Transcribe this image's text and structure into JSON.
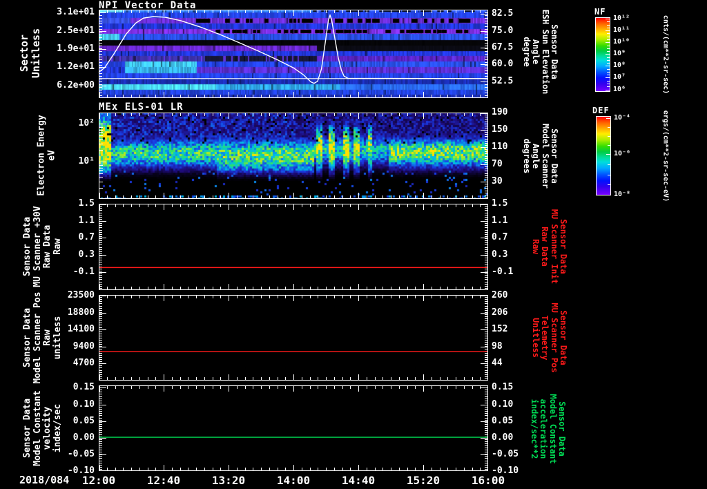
{
  "figure": {
    "background": "#000000",
    "date_label": "2018/084",
    "x_tick_labels": [
      "12:00",
      "12:40",
      "13:20",
      "14:00",
      "14:40",
      "15:20",
      "16:00"
    ]
  },
  "panels": [
    {
      "title": "NPI Vector Data",
      "left_label_lines": [
        "Sector",
        "Unitless"
      ],
      "left_ticks": [
        "3.1e+01",
        "2.5e+01",
        "1.9e+01",
        "1.2e+01",
        "6.2e+00"
      ],
      "right_ticks": [
        "82.5",
        "75.0",
        "67.5",
        "60.0",
        "52.5"
      ],
      "right_label_lines": [
        "Sensor Data",
        "ESH Sun Elevation",
        "Angle",
        "degree"
      ],
      "right_label_color": "#ffffff"
    },
    {
      "title": "MEx ELS-01 LR",
      "left_label_lines": [
        "Electron Energy",
        "eV"
      ],
      "left_ticks": [
        "10²",
        "10¹"
      ],
      "right_ticks": [
        "190",
        "150",
        "110",
        "70",
        "30"
      ],
      "right_label_lines": [
        "Sensor Data",
        "Model Scanner",
        "Angle",
        "degrees"
      ],
      "right_label_color": "#ffffff"
    },
    {
      "title": "",
      "left_label_lines": [
        "Sensor Data",
        "MU Scanner +30V",
        "Raw Data",
        "Raw"
      ],
      "left_ticks": [
        "1.5",
        "1.1",
        "0.7",
        "0.3",
        "-0.1"
      ],
      "right_ticks": [
        "1.5",
        "1.1",
        "0.7",
        "0.3",
        "-0.1"
      ],
      "right_label_lines": [
        "Sensor Data",
        "MU Scanner Init",
        "Raw Data",
        "Raw"
      ],
      "right_label_color": "#ff1a1a"
    },
    {
      "title": "",
      "left_label_lines": [
        "Sensor Data",
        "Model Scanner Pos",
        "Raw",
        "unitless"
      ],
      "left_ticks": [
        "23500",
        "18800",
        "14100",
        "9400",
        "4700"
      ],
      "right_ticks": [
        "260",
        "206",
        "152",
        "98",
        "44"
      ],
      "right_label_lines": [
        "Sensor Data",
        "MU Scanner Pos",
        "Telemetry",
        "Unitless"
      ],
      "right_label_color": "#ff1a1a"
    },
    {
      "title": "",
      "left_label_lines": [
        "Sensor Data",
        "Model Constant",
        "velocity",
        "index/sec"
      ],
      "left_ticks": [
        "0.15",
        "0.10",
        "0.05",
        "0.00",
        "-0.05",
        "-0.10"
      ],
      "right_ticks": [
        "0.15",
        "0.10",
        "0.05",
        "0.00",
        "-0.05",
        "-0.10"
      ],
      "right_label_lines": [
        "Sensor Data",
        "Model Constant",
        "acceleration",
        "index/sec**2"
      ],
      "right_label_color": "#00dd55"
    }
  ],
  "colorbars": [
    {
      "title": "NF",
      "tick_labels": [
        "10¹²",
        "10¹¹",
        "10¹⁰",
        "10⁹",
        "10⁸",
        "10⁷",
        "10⁶"
      ],
      "unit": "cnts/(cm**2-sr-sec)"
    },
    {
      "title": "DEF",
      "tick_labels": [
        "10⁻⁴",
        "10⁻⁶",
        "10⁻⁸"
      ],
      "unit": "ergs/(cm**2-sr-sec-eV)"
    }
  ],
  "chart_data": [
    {
      "type": "heatmap",
      "title": "NPI Vector Data",
      "ylabel": "Sector (Unitless)",
      "yticks": [
        "3.1e+01",
        "2.5e+01",
        "1.9e+01",
        "1.2e+01",
        "6.2e+00"
      ],
      "x_range": [
        "2018/084 12:00",
        "2018/084 16:00"
      ],
      "colorbar": {
        "name": "NF",
        "unit": "cnts/(cm**2-sr-sec)",
        "log_range": [
          1000000,
          1000000000000
        ]
      },
      "right_axis": {
        "label": "Sensor Data ESH Sun Elevation Angle (degree)",
        "ticks": [
          82.5,
          75.0,
          67.5,
          60.0,
          52.5
        ]
      },
      "sun_elevation_line": {
        "color": "#ffffff",
        "points": [
          [
            0,
            56.5
          ],
          [
            0.015,
            58.5
          ],
          [
            0.04,
            65
          ],
          [
            0.07,
            73.5
          ],
          [
            0.095,
            78.5
          ],
          [
            0.115,
            80.7
          ],
          [
            0.14,
            81.4
          ],
          [
            0.17,
            81.1
          ],
          [
            0.21,
            79.6
          ],
          [
            0.26,
            76.8
          ],
          [
            0.31,
            73.5
          ],
          [
            0.36,
            69.8
          ],
          [
            0.41,
            66
          ],
          [
            0.46,
            62
          ],
          [
            0.5,
            58.5
          ],
          [
            0.525,
            55.5
          ],
          [
            0.545,
            52.2
          ],
          [
            0.553,
            51.6
          ],
          [
            0.562,
            52.5
          ],
          [
            0.572,
            58
          ],
          [
            0.582,
            70
          ],
          [
            0.59,
            80
          ],
          [
            0.594,
            82
          ],
          [
            0.598,
            80
          ],
          [
            0.606,
            72
          ],
          [
            0.615,
            63
          ],
          [
            0.623,
            57.5
          ],
          [
            0.63,
            54.8
          ],
          [
            0.64,
            53.8
          ],
          [
            1,
            53.7
          ]
        ]
      },
      "reference_line_deg": 53.7,
      "bands": [
        {
          "y": [
            0,
            0.035
          ],
          "segs": [
            [
              0,
              0.06,
              "#66e0ff"
            ],
            [
              0.06,
              0.55,
              "#2f7bff"
            ],
            [
              0.55,
              1,
              "#2a52f0"
            ]
          ]
        },
        {
          "y": [
            0.035,
            0.095
          ],
          "segs": [
            [
              0,
              1,
              "#2443e8"
            ]
          ]
        },
        {
          "y": [
            0.095,
            0.155
          ],
          "segs": [
            [
              0,
              0.08,
              "#3a55ee"
            ],
            [
              0.08,
              1,
              "#6d2fd6"
            ]
          ]
        },
        {
          "y": [
            0.155,
            0.215
          ],
          "segs": [
            [
              0,
              1,
              "#2136d6"
            ]
          ]
        },
        {
          "y": [
            0.215,
            0.275
          ],
          "segs": [
            [
              0,
              1,
              "#7b2fe0"
            ]
          ]
        },
        {
          "y": [
            0.275,
            0.34
          ],
          "segs": [
            [
              0,
              0.05,
              "#45c8f0"
            ],
            [
              0.05,
              1,
              "#2950e8"
            ]
          ]
        },
        {
          "y": [
            0.34,
            0.405
          ],
          "segs": [
            [
              0,
              1,
              "#060609"
            ]
          ]
        },
        {
          "y": [
            0.405,
            0.465
          ],
          "segs": [
            [
              0,
              0.56,
              "#6a28cf"
            ],
            [
              0.56,
              1,
              "#0b0b14"
            ]
          ]
        },
        {
          "y": [
            0.465,
            0.525
          ],
          "segs": [
            [
              0,
              1,
              "#2136d6"
            ]
          ]
        },
        {
          "y": [
            0.525,
            0.585
          ],
          "segs": [
            [
              0,
              0.27,
              "#3a2fa0"
            ],
            [
              0.27,
              0.56,
              "#171738"
            ],
            [
              0.56,
              1,
              "#5a24c4"
            ]
          ],
          "spk": "#5a2fd0"
        },
        {
          "y": [
            0.585,
            0.65
          ],
          "segs": [
            [
              0,
              0.065,
              "#2443e8"
            ],
            [
              0.065,
              0.25,
              "#3fc4f2"
            ],
            [
              0.25,
              0.56,
              "#2443e8"
            ],
            [
              0.56,
              1,
              "#2a52f0"
            ]
          ]
        },
        {
          "y": [
            0.65,
            0.715
          ],
          "segs": [
            [
              0,
              0.065,
              "#2136d6"
            ],
            [
              0.065,
              0.25,
              "#35aee6"
            ],
            [
              0.25,
              1,
              "#5a2fd0"
            ]
          ]
        },
        {
          "y": [
            0.715,
            0.78
          ],
          "segs": [
            [
              0,
              1,
              "#2443e8"
            ]
          ]
        },
        {
          "y": [
            0.78,
            0.845
          ],
          "segs": [
            [
              0,
              1,
              "#1a2db0"
            ]
          ]
        },
        {
          "y": [
            0.845,
            0.905
          ],
          "segs": [
            [
              0,
              0.3,
              "#49d6f2"
            ],
            [
              0.3,
              0.62,
              "#2fa6e8"
            ],
            [
              0.62,
              1,
              "#2a6bf5"
            ]
          ]
        },
        {
          "y": [
            0.905,
            0.96
          ],
          "segs": [
            [
              0,
              1,
              "#2141d9"
            ]
          ]
        },
        {
          "y": [
            0.96,
            1
          ],
          "segs": [
            [
              0,
              1,
              "#1a2db0"
            ]
          ]
        }
      ],
      "black_dashes": [
        {
          "band": 0,
          "t": [
            0.55,
            1
          ],
          "p": 0.4
        },
        {
          "band": 2,
          "t": [
            0.25,
            0.95
          ],
          "p": 0.35
        },
        {
          "band": 4,
          "t": [
            0.3,
            0.95
          ],
          "p": 0.45
        }
      ]
    },
    {
      "type": "heatmap",
      "title": "MEx ELS-01 LR",
      "ylabel": "Electron Energy (eV)",
      "yticks": [
        "10²",
        "10¹"
      ],
      "yscale": "log",
      "colorbar": {
        "name": "DEF",
        "unit": "ergs/(cm**2-sr-sec-eV)",
        "log_range": [
          1e-08,
          0.0001
        ]
      },
      "right_axis": {
        "label": "Sensor Data Model Scanner Angle (degrees)",
        "ticks": [
          190,
          150,
          110,
          70,
          30
        ]
      },
      "texture": {
        "band_center_frac": 0.46,
        "band_sigma": 0.11,
        "base_amp": 0.72,
        "left_burst": {
          "t_max": 0.028,
          "amp": 1.2,
          "sigma": 0.23,
          "center": 0.36
        },
        "mid_region": {
          "t0": 0.3,
          "t1": 0.55,
          "amp": 0.8,
          "center": 0.49,
          "sigma": 0.13
        },
        "gap_region": {
          "t0": 0.55,
          "t1": 0.74,
          "amp": 0.6,
          "center": 0.42
        },
        "right_region": {
          "t_min": 0.74,
          "amp": 0.85,
          "center": 0.45
        },
        "streaks": [
          [
            0.555,
            0.572
          ],
          [
            0.588,
            0.602
          ],
          [
            0.625,
            0.642
          ],
          [
            0.652,
            0.668
          ],
          [
            0.688,
            0.702
          ]
        ],
        "streak_amp": 1.05,
        "bottom_black_frac": 0.66
      }
    },
    {
      "type": "line",
      "series": [
        {
          "name": "Sensor Data MU Scanner +30V Raw Data Raw",
          "value": 0.0,
          "color": "#ff1a1a"
        }
      ],
      "yticks": [
        1.5,
        1.1,
        0.7,
        0.3,
        -0.1
      ],
      "right_axis": {
        "label": "Sensor Data MU Scanner Init Raw Data Raw",
        "ticks": [
          1.5,
          1.1,
          0.7,
          0.3,
          -0.1
        ]
      }
    },
    {
      "type": "line",
      "series": [
        {
          "name": "Sensor Data Model Scanner Pos Raw unitless",
          "value": 7970,
          "color": "#ff1a1a"
        }
      ],
      "yticks": [
        23500,
        18800,
        14100,
        9400,
        4700
      ],
      "right_axis": {
        "label": "Sensor Data MU Scanner Pos Telemetry Unitless",
        "ticks": [
          260,
          206,
          152,
          98,
          44
        ]
      }
    },
    {
      "type": "line",
      "series": [
        {
          "name": "Sensor Data Model Constant velocity index/sec",
          "value": 0.0,
          "color": "#00dd55"
        }
      ],
      "yticks": [
        0.15,
        0.1,
        0.05,
        0.0,
        -0.05,
        -0.1
      ],
      "right_axis": {
        "label": "Sensor Data Model Constant acceleration index/sec**2",
        "ticks": [
          0.15,
          0.1,
          0.05,
          0.0,
          -0.05,
          -0.1
        ]
      }
    }
  ]
}
